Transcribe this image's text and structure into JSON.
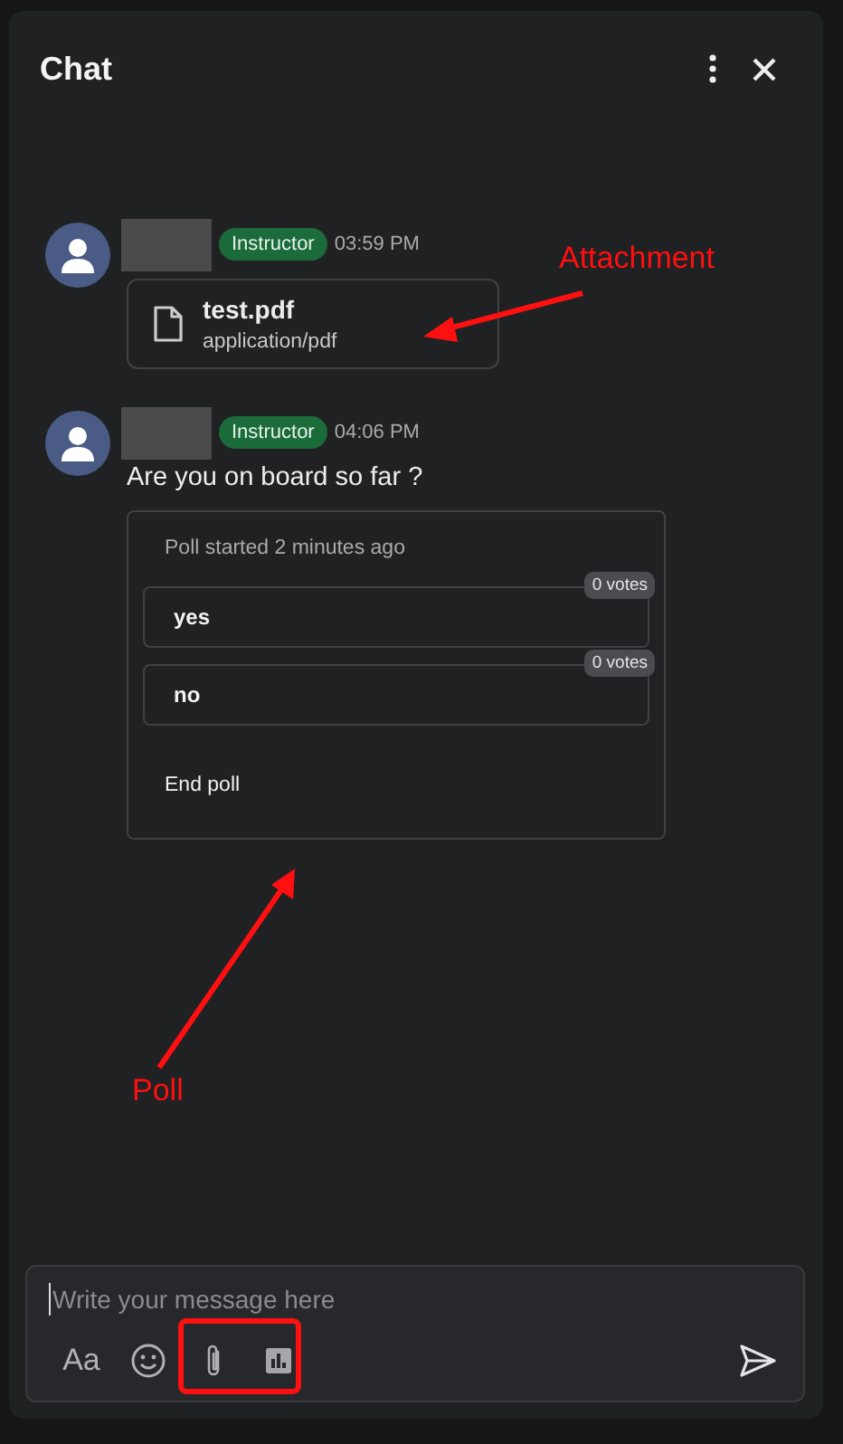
{
  "window": {
    "title": "Chat"
  },
  "messages": [
    {
      "role": "Instructor",
      "time": "03:59 PM",
      "attachment": {
        "filename": "test.pdf",
        "mimetype": "application/pdf"
      }
    },
    {
      "role": "Instructor",
      "time": "04:06 PM",
      "text": "Are you on board so far ?",
      "poll": {
        "status": "Poll started 2 minutes ago",
        "options": [
          {
            "label": "yes",
            "votes": "0 votes"
          },
          {
            "label": "no",
            "votes": "0 votes"
          }
        ],
        "action": "End poll"
      }
    }
  ],
  "composer": {
    "placeholder": "Write your message here",
    "tools": [
      {
        "kind": "format",
        "label": "Aa"
      },
      {
        "kind": "emoji"
      },
      {
        "kind": "attach"
      },
      {
        "kind": "poll"
      },
      {
        "kind": "send"
      }
    ]
  },
  "annotations": [
    {
      "kind": "arrow-label",
      "text": "Attachment"
    },
    {
      "kind": "arrow-label",
      "text": "Poll"
    },
    {
      "kind": "highlight"
    }
  ]
}
